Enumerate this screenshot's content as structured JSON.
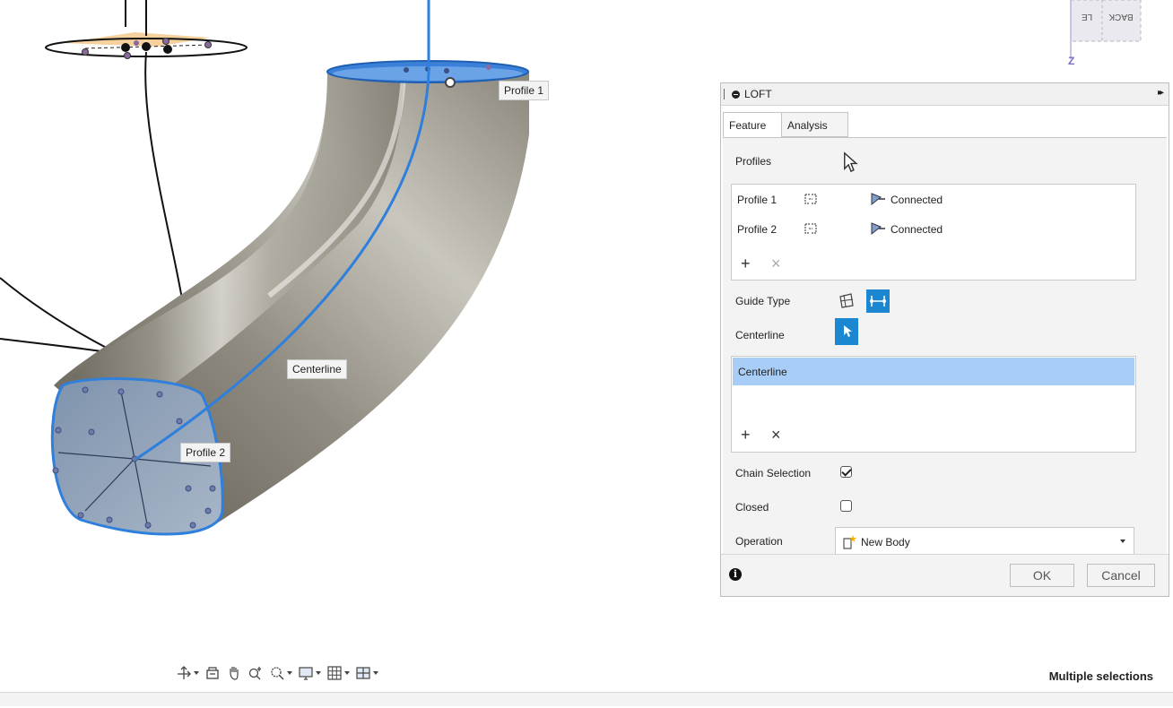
{
  "viewport": {
    "profile1_label": "Profile 1",
    "profile2_label": "Profile 2",
    "centerline_label": "Centerline",
    "viewcube_face": "BACK",
    "viewcube_side": "LE",
    "axis_label": "Z"
  },
  "loft": {
    "title": "LOFT",
    "tabs": [
      "Feature",
      "Analysis"
    ],
    "profiles_label": "Profiles",
    "profiles": [
      {
        "name": "Profile 1",
        "status": "Connected"
      },
      {
        "name": "Profile 2",
        "status": "Connected"
      }
    ],
    "guide_type_label": "Guide Type",
    "centerline_label": "Centerline",
    "centerline_items": [
      "Centerline"
    ],
    "chain_selection_label": "Chain Selection",
    "chain_selection_checked": true,
    "closed_label": "Closed",
    "closed_checked": false,
    "operation_label": "Operation",
    "operation_value": "New Body",
    "ok_label": "OK",
    "cancel_label": "Cancel"
  },
  "toolbar": {
    "icons": [
      "orbit-icon",
      "look-at-icon",
      "pan-icon",
      "zoom-icon",
      "fit-icon",
      "display-settings-icon",
      "grid-icon",
      "viewports-icon"
    ]
  },
  "status": {
    "text": "Multiple selections"
  },
  "colors": {
    "accent": "#1c87d1",
    "selection": "#a8cdf7",
    "profile_blue": "#2f7fdc"
  }
}
